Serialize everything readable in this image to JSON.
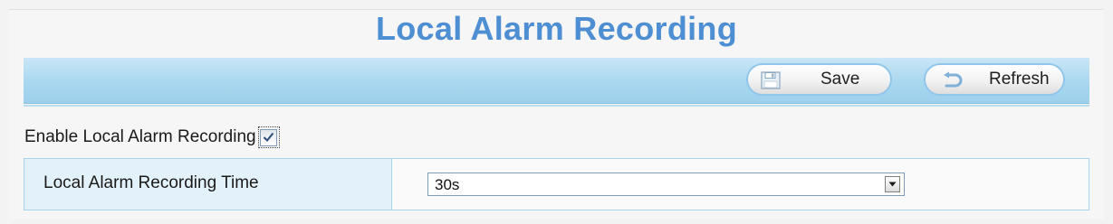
{
  "page": {
    "title": "Local Alarm Recording"
  },
  "toolbar": {
    "save_label": "Save",
    "save_icon": "floppy-disk-icon",
    "refresh_label": "Refresh",
    "refresh_icon": "refresh-arrow-icon"
  },
  "form": {
    "enable_label": "Enable Local Alarm Recording",
    "enable_checked": true,
    "recording_time_label": "Local Alarm Recording Time",
    "recording_time_value": "30s"
  },
  "colors": {
    "title": "#4e8ed2",
    "toolbar": "#a9d7ef",
    "label_cell": "#e3f1fa",
    "border": "#a9d2ec"
  }
}
